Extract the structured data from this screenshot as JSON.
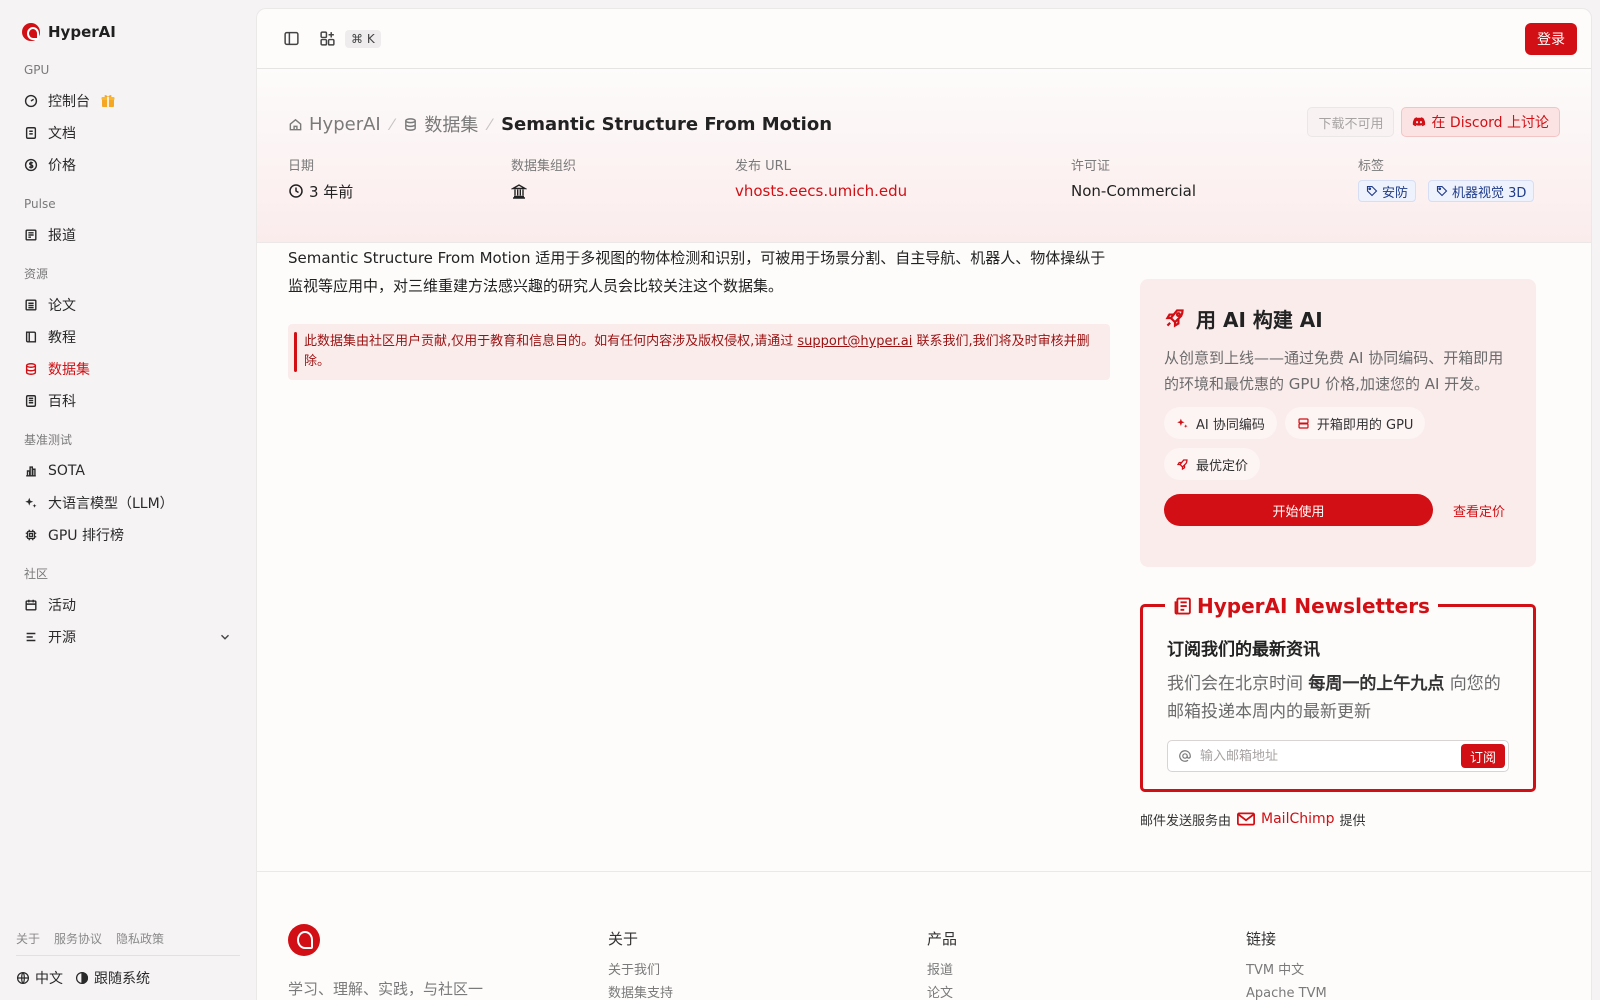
{
  "brand": {
    "name": "HyperAI"
  },
  "sidebar": {
    "sections": {
      "gpu": "GPU",
      "pulse": "Pulse",
      "resources": "资源",
      "benchmark": "基准测试",
      "community": "社区"
    },
    "items": {
      "console": "控制台",
      "docs": "文档",
      "pricing": "价格",
      "news": "报道",
      "papers": "论文",
      "tutorials": "教程",
      "datasets": "数据集",
      "wiki": "百科",
      "sota": "SOTA",
      "llm": "大语言模型（LLM）",
      "gpu_leaderboard": "GPU 排行榜",
      "events": "活动",
      "open_source": "开源"
    },
    "footer_links": [
      "关于",
      "服务协议",
      "隐私政策"
    ],
    "language": "中文",
    "theme": "跟随系统"
  },
  "topbar": {
    "shortcut": "⌘ K",
    "login": "登录"
  },
  "breadcrumb": {
    "home": "HyperAI",
    "section": "数据集",
    "current": "Semantic Structure From Motion"
  },
  "actions": {
    "download": "下载不可用",
    "discord": "在 Discord 上讨论"
  },
  "meta": {
    "date_label": "日期",
    "date_value": "3 年前",
    "org_label": "数据集组织",
    "url_label": "发布 URL",
    "url_value": "vhosts.eecs.umich.edu",
    "license_label": "许可证",
    "license_value": "Non-Commercial",
    "tags_label": "标签",
    "tags": [
      "安防",
      "机器视觉 3D"
    ]
  },
  "description": "Semantic Structure From Motion 适用于多视图的物体检测和识别，可被用于场景分割、自主导航、机器人、物体操纵于监视等应用中，对三维重建方法感兴趣的研究人员会比较关注这个数据集。",
  "notice": {
    "before": "此数据集由社区用户贡献,仅用于教育和信息目的。如有任何内容涉及版权侵权,请通过 ",
    "email": "support@hyper.ai",
    "after": " 联系我们,我们将及时审核并删除。"
  },
  "promo": {
    "title": "用 AI 构建 AI",
    "desc": "从创意到上线——通过免费 AI 协同编码、开箱即用的环境和最优惠的 GPU 价格,加速您的 AI 开发。",
    "chips": [
      "AI 协同编码",
      "开箱即用的 GPU",
      "最优定价"
    ],
    "start": "开始使用",
    "pricing": "查看定价"
  },
  "newsletter": {
    "legend": "HyperAI Newsletters",
    "title": "订阅我们的最新资讯",
    "text_before": "我们会在北京时间 ",
    "text_bold": "每周一的上午九点",
    "text_after": " 向您的邮箱投递本周内的最新更新",
    "placeholder": "输入邮箱地址",
    "subscribe": "订阅",
    "credit_before": "邮件发送服务由",
    "credit_brand": "MailChimp",
    "credit_after": "提供"
  },
  "footer": {
    "tagline": "学习、理解、实践，与社区一起构建人工智能的未来",
    "cols": [
      {
        "title": "关于",
        "items": [
          "关于我们",
          "数据集支持"
        ]
      },
      {
        "title": "产品",
        "items": [
          "报道",
          "论文"
        ]
      },
      {
        "title": "链接",
        "items": [
          "TVM 中文",
          "Apache TVM"
        ]
      }
    ]
  },
  "colors": {
    "accent": "#d10f14",
    "tint": "#fbecec"
  },
  "icons": {
    "nav": [
      "dashboard-icon",
      "file-icon",
      "dollar-icon",
      "newspaper-icon",
      "list-icon",
      "book-icon",
      "database-icon",
      "page-icon",
      "bar-chart-icon",
      "sparkle-icon",
      "chip-icon",
      "calendar-icon",
      "menu-icon"
    ]
  }
}
